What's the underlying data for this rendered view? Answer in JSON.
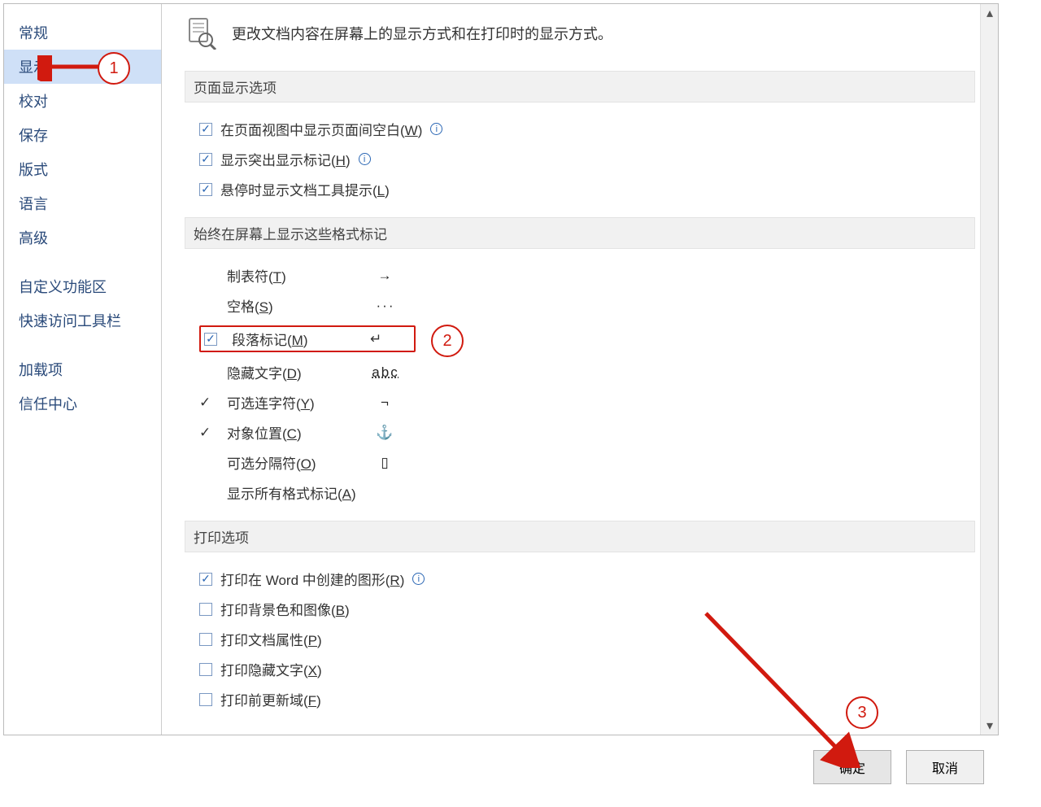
{
  "header": {
    "desc": "更改文档内容在屏幕上的显示方式和在打印时的显示方式。"
  },
  "sidebar": {
    "items": [
      "常规",
      "显示",
      "校对",
      "保存",
      "版式",
      "语言",
      "高级"
    ],
    "items2": [
      "自定义功能区",
      "快速访问工具栏"
    ],
    "items3": [
      "加载项",
      "信任中心"
    ],
    "selected": 1
  },
  "sections": {
    "page_display": {
      "title": "页面显示选项",
      "opts": [
        {
          "label": "在页面视图中显示页面间空白(",
          "k": "W",
          "tail": ")",
          "checked": true,
          "info": true
        },
        {
          "label": "显示突出显示标记(",
          "k": "H",
          "tail": ")",
          "checked": true,
          "info": true
        },
        {
          "label": "悬停时显示文档工具提示(",
          "k": "L",
          "tail": ")",
          "checked": true,
          "info": false
        }
      ]
    },
    "fmt_marks": {
      "title": "始终在屏幕上显示这些格式标记",
      "rows": [
        {
          "label": "制表符(",
          "k": "T",
          "tail": ")",
          "sym": "→",
          "checked": false
        },
        {
          "label": "空格(",
          "k": "S",
          "tail": ")",
          "sym": "···",
          "checked": false
        },
        {
          "label": "段落标记(",
          "k": "M",
          "tail": ")",
          "sym": "↵",
          "checked": true,
          "highlight": true
        },
        {
          "label": "隐藏文字(",
          "k": "D",
          "tail": ")",
          "sym": "abc",
          "strike": true,
          "checked": false
        },
        {
          "label": "可选连字符(",
          "k": "Y",
          "tail": ")",
          "sym": "¬",
          "checked": true
        },
        {
          "label": "对象位置(",
          "k": "C",
          "tail": ")",
          "sym": "⚓",
          "checked": true
        },
        {
          "label": "可选分隔符(",
          "k": "O",
          "tail": ")",
          "sym": "▯",
          "checked": false
        },
        {
          "label": "显示所有格式标记(",
          "k": "A",
          "tail": ")",
          "sym": "",
          "checked": false
        }
      ]
    },
    "print": {
      "title": "打印选项",
      "opts": [
        {
          "label": "打印在 Word 中创建的图形(",
          "k": "R",
          "tail": ")",
          "checked": true,
          "info": true
        },
        {
          "label": "打印背景色和图像(",
          "k": "B",
          "tail": ")",
          "checked": false
        },
        {
          "label": "打印文档属性(",
          "k": "P",
          "tail": ")",
          "checked": false
        },
        {
          "label": "打印隐藏文字(",
          "k": "X",
          "tail": ")",
          "checked": false
        },
        {
          "label": "打印前更新域(",
          "k": "F",
          "tail": ")",
          "checked": false
        }
      ]
    }
  },
  "buttons": {
    "ok": "确定",
    "cancel": "取消"
  },
  "annot": {
    "n1": "1",
    "n2": "2",
    "n3": "3"
  }
}
